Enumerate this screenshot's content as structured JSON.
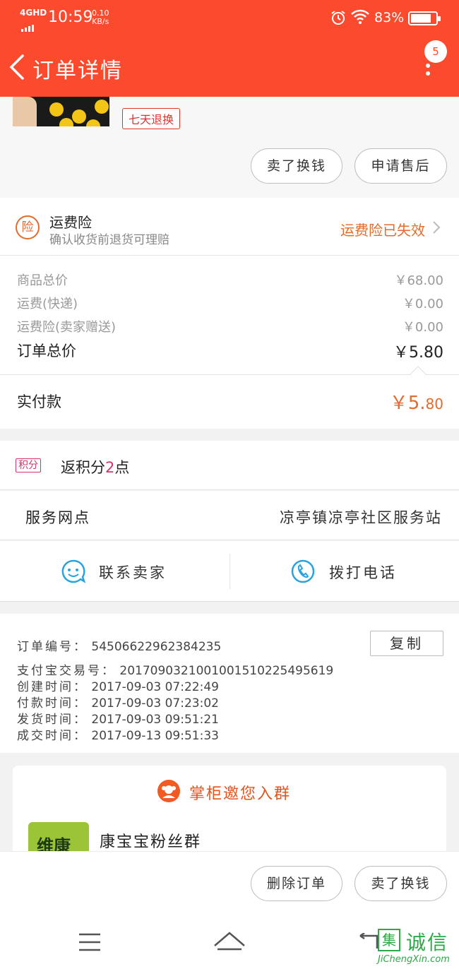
{
  "status_bar": {
    "network": "4GHD",
    "time": "10:59",
    "speed_value": "0.10",
    "speed_unit": "KB/s",
    "battery_pct": "83%",
    "battery_level": 0.83
  },
  "header": {
    "title": "订单详情",
    "notification_count": "5",
    "bg_color": "#fb4a2e"
  },
  "product": {
    "return_tag": "七天退换",
    "buttons": [
      "卖了换钱",
      "申请售后"
    ]
  },
  "freight_insurance": {
    "icon_char": "险",
    "title": "运费险",
    "subtitle": "确认收货前退货可理赔",
    "status": "运费险已失效"
  },
  "prices": {
    "rows": [
      {
        "label": "商品总价",
        "value": "￥68.00"
      },
      {
        "label": "运费(快递)",
        "value": "￥0.00"
      },
      {
        "label": "运费险(卖家赠送)",
        "value": "￥0.00"
      }
    ],
    "total_label": "订单总价",
    "total_value": "￥5.80",
    "paid_label": "实付款",
    "paid_main": "￥5.",
    "paid_decimal": "80"
  },
  "points": {
    "tag": "积分",
    "prefix": "返积分",
    "amount": "2",
    "suffix": "点"
  },
  "service": {
    "label": "服务网点",
    "value": "凉亭镇凉亭社区服务站"
  },
  "contact": {
    "seller_label": "联系卖家",
    "phone_label": "拨打电话"
  },
  "order_info": {
    "copy_label": "复制",
    "rows": [
      {
        "key": "订单编号：",
        "value": "54506622962384235"
      },
      {
        "key": "支付宝交易号：",
        "value": "2017090321001001510225495619"
      },
      {
        "key": "创建时间：",
        "value": "2017-09-03 07:22:49"
      },
      {
        "key": "付款时间：",
        "value": "2017-09-03 07:23:02"
      },
      {
        "key": "发货时间：",
        "value": "2017-09-03 09:51:21"
      },
      {
        "key": "成交时间：",
        "value": "2017-09-13 09:51:33"
      }
    ]
  },
  "group": {
    "title": "掌柜邀您入群",
    "logo_text": "维康",
    "name": "康宝宝粉丝群"
  },
  "action_bar": {
    "delete_label": "删除订单",
    "sell_label": "卖了换钱"
  },
  "watermark": {
    "mark": "集",
    "text": "诚信",
    "sub": "JiChengXin.com"
  }
}
